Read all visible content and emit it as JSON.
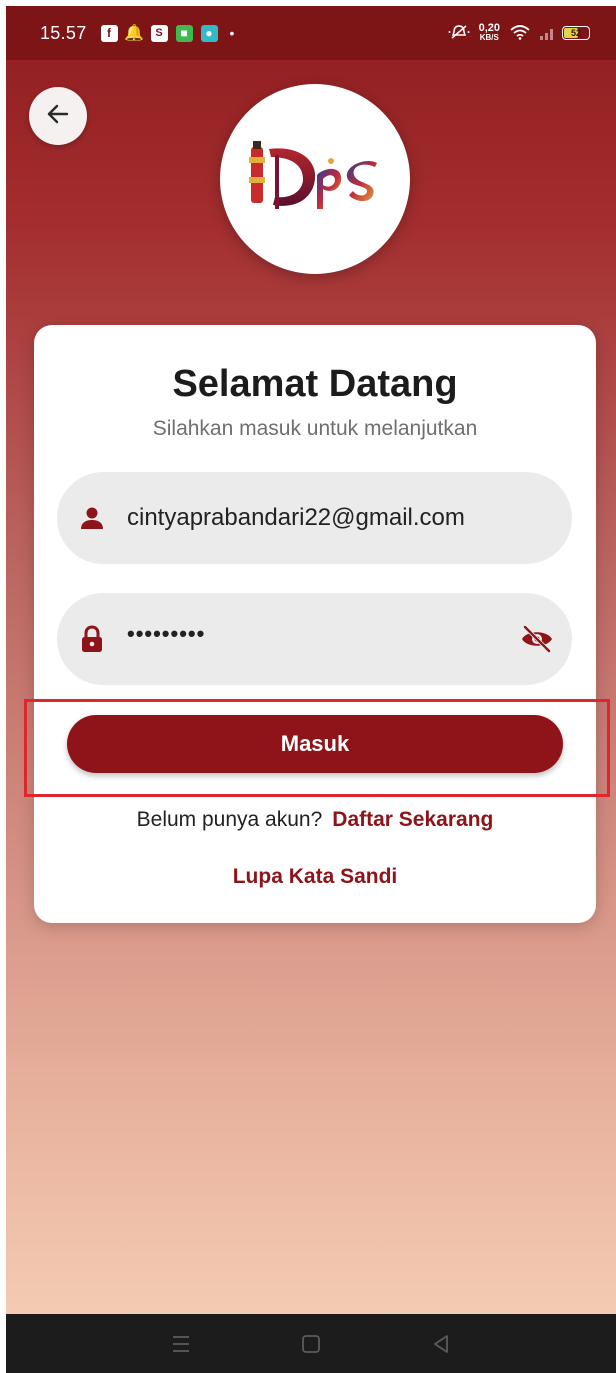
{
  "status_bar": {
    "time": "15.57",
    "dot": "•",
    "net_speed_value": "0,20",
    "net_speed_unit": "KB/S",
    "battery_level": "52"
  },
  "card": {
    "title": "Selamat Datang",
    "subtitle": "Silahkan masuk untuk melanjutkan"
  },
  "form": {
    "email_value": "cintyaprabandari22@gmail.com",
    "password_masked": "•••••••••"
  },
  "buttons": {
    "login_label": "Masuk"
  },
  "links": {
    "signup_prompt": "Belum punya akun?",
    "signup_label": "Daftar Sekarang",
    "forgot_label": "Lupa Kata Sandi"
  },
  "colors": {
    "primary": "#8e1419",
    "highlight": "#e0262d"
  }
}
